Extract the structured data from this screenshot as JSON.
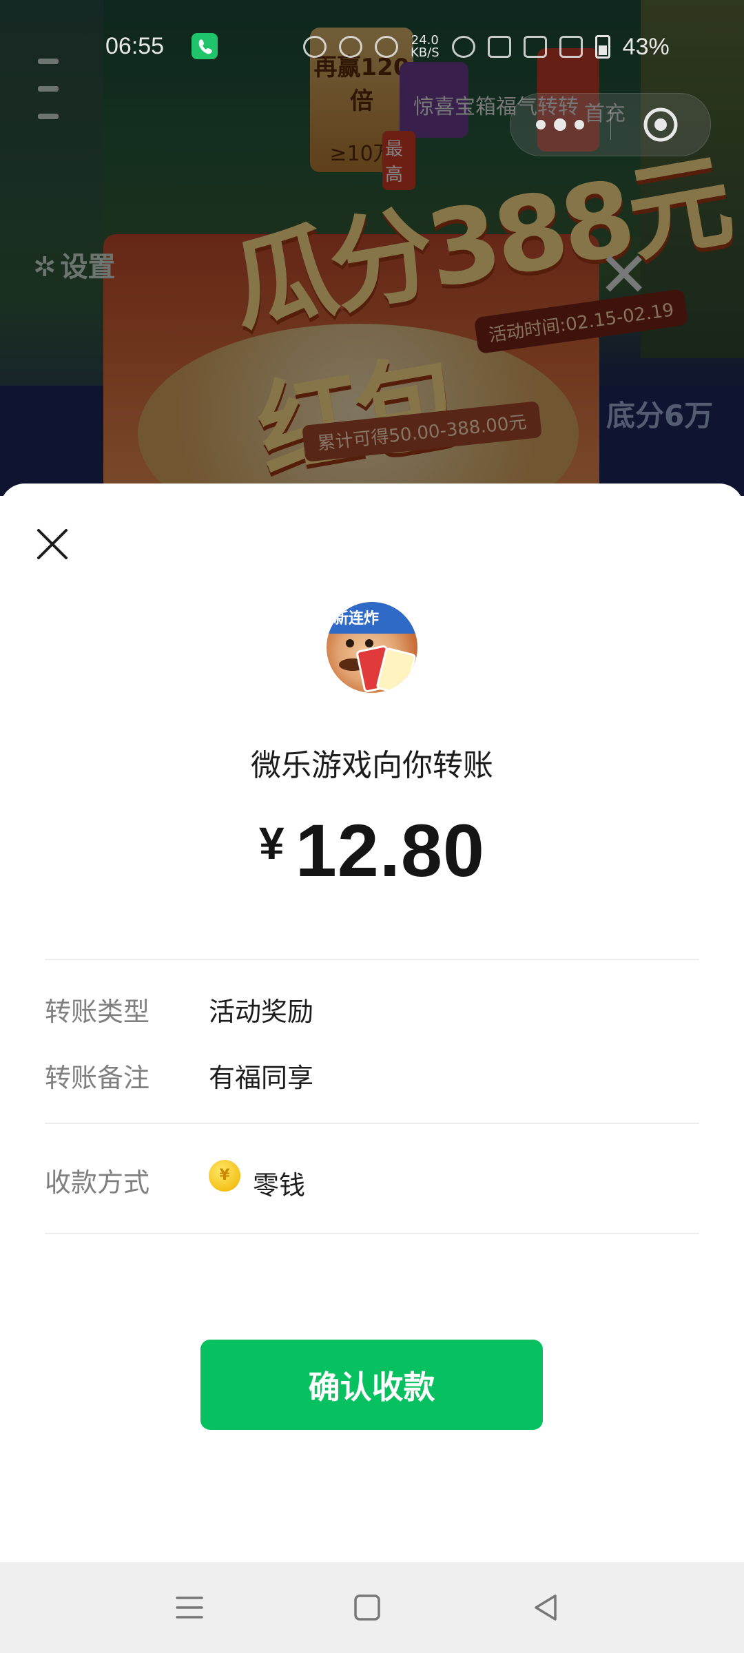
{
  "status_bar": {
    "time": "06:55",
    "network_speed": "24.0",
    "network_unit": "KB/S",
    "battery": "43%"
  },
  "background_game": {
    "settings_label": "设置",
    "banner_title": "瓜分388元红包",
    "banner_tag": "活动时间:02.15-02.19",
    "banner_sub": "累计可得50.00-388.00元",
    "right_text": "底分6万",
    "top_chip_text": "再赢120倍",
    "top_chip_sub": "≥10万",
    "chip_labels": [
      "惊喜宝箱",
      "福气转转",
      "首充"
    ],
    "best_badge": "最高"
  },
  "sheet": {
    "avatar_badge_text": "新连炸",
    "payer_text": "微乐游戏向你转账",
    "currency_symbol": "¥",
    "amount": "12.80",
    "details": [
      {
        "label": "转账类型",
        "value": "活动奖励"
      },
      {
        "label": "转账备注",
        "value": "有福同享"
      }
    ],
    "payment_method": {
      "label": "收款方式",
      "value": "零钱",
      "coin_symbol": "¥"
    },
    "confirm_label": "确认收款"
  },
  "colors": {
    "primary_green": "#07c160",
    "coin_yellow": "#f4c21a",
    "label_gray": "#7f7f7f"
  },
  "icons": {
    "close": "close-icon",
    "capsule_more": "more-dots-icon",
    "capsule_exit": "target-exit-icon",
    "nav_menu": "menu-icon",
    "nav_home": "home-square-icon",
    "nav_back": "back-triangle-icon"
  }
}
